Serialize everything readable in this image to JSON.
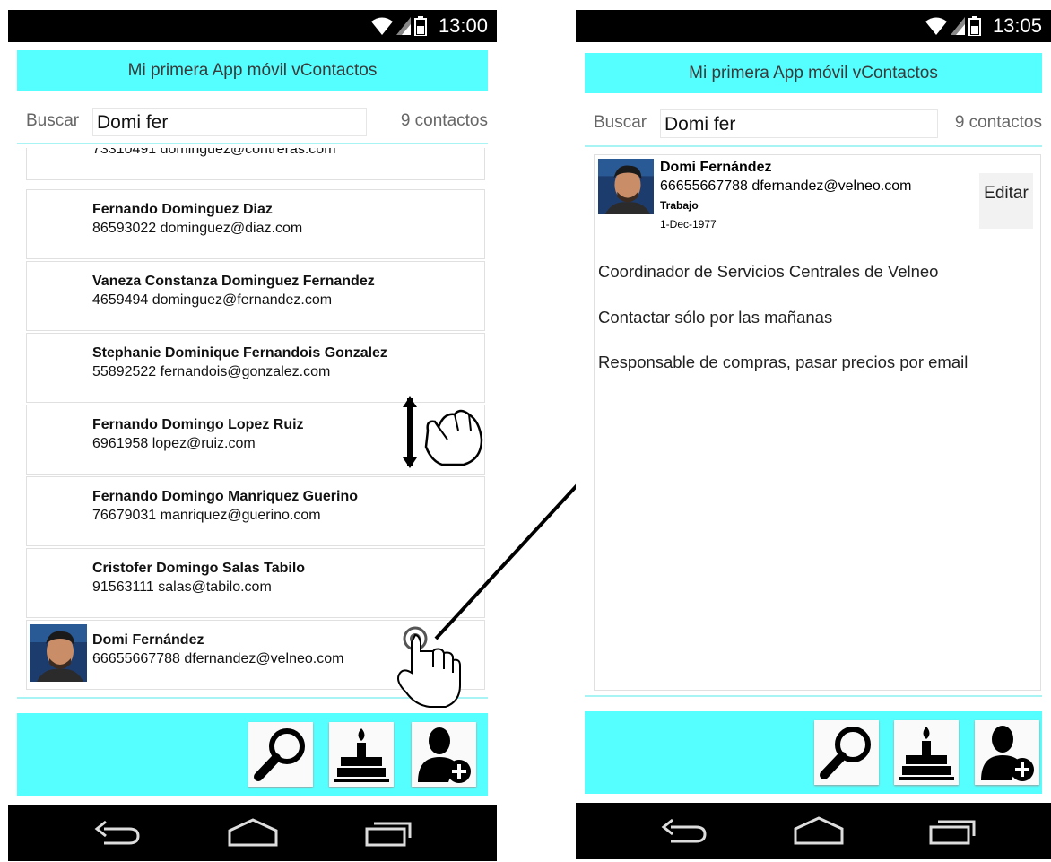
{
  "left": {
    "status_time": "13:00",
    "title": "Mi primera App móvil vContactos",
    "search_label": "Buscar",
    "search_value": "Domi fer",
    "count": "9 contactos",
    "partial_row": "73310491 dominguez@contreras.com",
    "contacts": [
      {
        "name": "Fernando Dominguez Diaz",
        "sub": "86593022 dominguez@diaz.com"
      },
      {
        "name": "Vaneza Constanza Dominguez Fernandez",
        "sub": "4659494 dominguez@fernandez.com"
      },
      {
        "name": "Stephanie Dominique Fernandois Gonzalez",
        "sub": "55892522 fernandois@gonzalez.com"
      },
      {
        "name": "Fernando Domingo Lopez Ruiz",
        "sub": "6961958 lopez@ruiz.com"
      },
      {
        "name": "Fernando Domingo Manriquez Guerino",
        "sub": "76679031 manriquez@guerino.com"
      },
      {
        "name": "Cristofer Domingo Salas Tabilo",
        "sub": "91563111 salas@tabilo.com"
      },
      {
        "name": "Domi Fernández",
        "sub": "66655667788 dfernandez@velneo.com"
      }
    ]
  },
  "right": {
    "status_time": "13:05",
    "title": "Mi primera App móvil vContactos",
    "search_label": "Buscar",
    "search_value": "Domi fer",
    "count": "9 contactos",
    "detail": {
      "name": "Domi Fernández",
      "sub": "66655667788 dfernandez@velneo.com",
      "tag": "Trabajo",
      "date": "1-Dec-1977",
      "edit_label": "Editar",
      "notes": [
        "Coordinador de Servicios Centrales de Velneo",
        "Contactar sólo por las mañanas",
        "Responsable de compras, pasar precios por email"
      ]
    }
  },
  "colors": {
    "accent": "#55ffff",
    "bars": "#000000"
  },
  "icons": [
    "wifi-icon",
    "signal-icon",
    "battery-icon",
    "search-icon",
    "birthday-cake-icon",
    "add-contact-icon",
    "back-icon",
    "home-icon",
    "recents-icon",
    "scroll-gesture-icon",
    "tap-gesture-icon"
  ]
}
